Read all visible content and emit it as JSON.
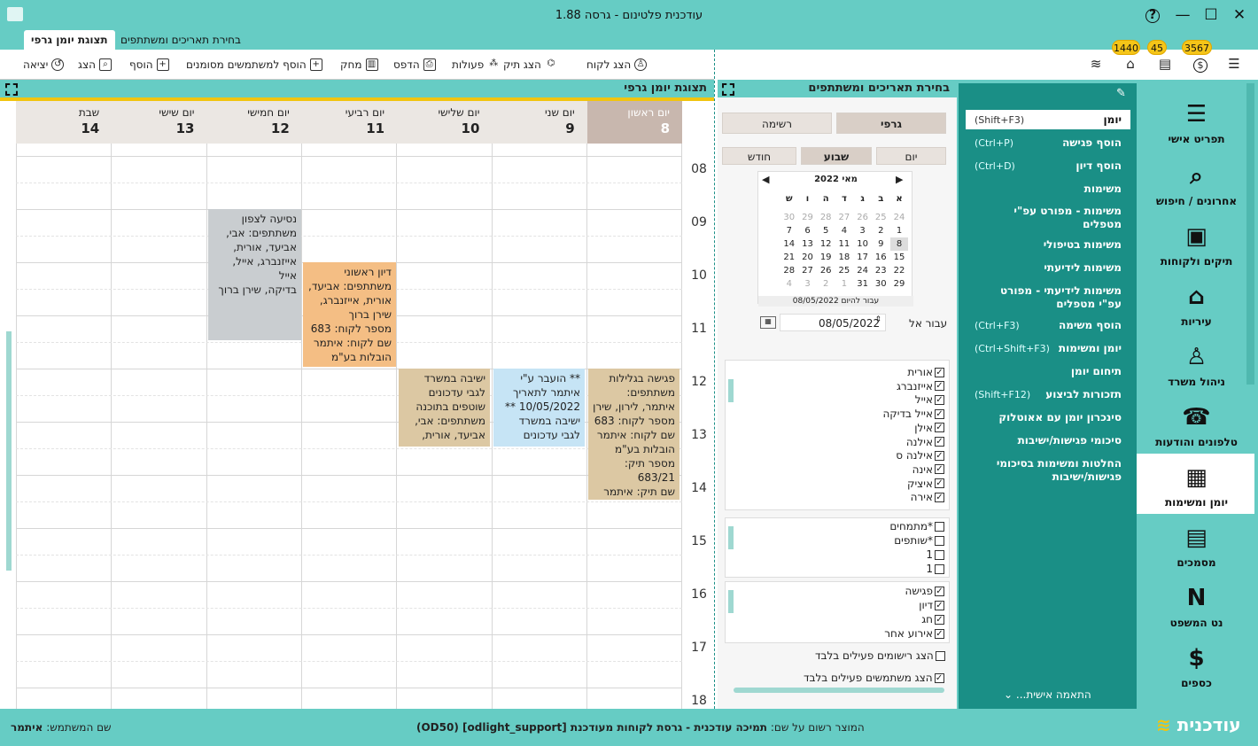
{
  "window": {
    "title": "עודכנית פלטינום - גרסה 1.88",
    "help": "?",
    "minimize": "—",
    "maximize": "☐",
    "close": "✕"
  },
  "tabs": [
    "תצוגת יומן גרפי",
    "בחירת תאריכים ומשתתפים"
  ],
  "toolbar": {
    "show_client": "הצג לקוח",
    "show_file": "הצג תיק",
    "actions": "פעולות",
    "print": "הדפס",
    "delete": "מחק",
    "add_marked": "הוסף למשתמשים מסומנים",
    "add": "הוסף",
    "show": "הצג",
    "exit": "יציאה"
  },
  "badges": [
    "1440",
    "45",
    "3567"
  ],
  "calendar": {
    "header": "תצוגת יומן גרפי",
    "days": [
      {
        "name": "יום ראשון",
        "date": "8"
      },
      {
        "name": "יום שני",
        "date": "9"
      },
      {
        "name": "יום שלישי",
        "date": "10"
      },
      {
        "name": "יום רביעי",
        "date": "11"
      },
      {
        "name": "יום חמישי",
        "date": "12"
      },
      {
        "name": "יום שישי",
        "date": "13"
      },
      {
        "name": "שבת",
        "date": "14"
      }
    ],
    "hours": [
      "08",
      "09",
      "10",
      "11",
      "12",
      "13",
      "14",
      "15",
      "16",
      "17",
      "18"
    ],
    "events": [
      {
        "text": "נסיעה לצפון\nמשתתפים: אבי,\nאביעד, אורית,\nאייזנברג, אייל, אייל\nבדיקה, שירן ברוך",
        "color": "#c9cdd0"
      },
      {
        "text": "דיון ראשוני\nמשתתפים: אביעד,\nאורית, אייזנברג,\nשירן ברוך\nמספר לקוח: 683\nשם לקוח: איתמר\nהובלות בע\"מ",
        "color": "#f4be84"
      },
      {
        "text": "ישיבה במשרד\nלגבי עדכונים\nשוטפים בתוכנה\nמשתתפים: אבי,\nאביעד, אורית,",
        "color": "#dcc8a3"
      },
      {
        "text": "** הועבר ע\"י\nאיתמר לתאריך\n10/05/2022 **\nישיבה במשרד\nלגבי עדכונים",
        "color": "#c6e4f5"
      },
      {
        "text": "פגישה בגלילות\nמשתתפים:\nאיתמר, לירון, שירן\nמספר לקוח: 683\nשם לקוח: איתמר\nהובלות בע\"מ\nמספר תיק:\n683/21\nשם תיק: איתמר",
        "color": "#dcc8a3"
      }
    ]
  },
  "dates_panel": {
    "header": "בחירת תאריכים ומשתתפים",
    "graphic": "גרפי",
    "list": "רשימה",
    "day": "יום",
    "week": "שבוע",
    "month": "חודש",
    "month_label": "מאי 2022",
    "weekday_headers": [
      "א",
      "ב",
      "ג",
      "ד",
      "ה",
      "ו",
      "ש"
    ],
    "weeks": [
      [
        "24",
        "25",
        "26",
        "27",
        "28",
        "29",
        "30"
      ],
      [
        "1",
        "2",
        "3",
        "4",
        "5",
        "6",
        "7"
      ],
      [
        "8",
        "9",
        "10",
        "11",
        "12",
        "13",
        "14"
      ],
      [
        "15",
        "16",
        "17",
        "18",
        "19",
        "20",
        "21"
      ],
      [
        "22",
        "23",
        "24",
        "25",
        "26",
        "27",
        "28"
      ],
      [
        "29",
        "30",
        "31",
        "1",
        "2",
        "3",
        "4"
      ]
    ],
    "goto_today": "עבור להיום 08/05/2022",
    "goto_label": "עבור אל",
    "goto_value": "08/05/2022",
    "users": [
      "אורית",
      "אייזנברג",
      "אייל",
      "אייל בדיקה",
      "אילן",
      "אילנה",
      "אילנה ס",
      "אינה",
      "איציק",
      "אירה"
    ],
    "groups": [
      "*מתמחים",
      "*שותפים",
      "1",
      "1"
    ],
    "types": [
      "פגישה",
      "דיון",
      "חג",
      "אירוע אחר"
    ],
    "show_active_records": "הצג רישומים פעילים בלבד",
    "show_active_users": "הצג משתמשים פעילים בלבד"
  },
  "menu": {
    "items": [
      {
        "label": "יומן",
        "shortcut": "(Shift+F3)"
      },
      {
        "label": "הוסף פגישה",
        "shortcut": "(Ctrl+P)"
      },
      {
        "label": "הוסף דיון",
        "shortcut": "(Ctrl+D)"
      },
      {
        "label": "משימות",
        "shortcut": ""
      },
      {
        "label": "משימות - מפורט עפ\"י\nמטפלים",
        "shortcut": ""
      },
      {
        "label": "משימות בטיפולי",
        "shortcut": ""
      },
      {
        "label": "משימות לידיעתי",
        "shortcut": ""
      },
      {
        "label": "משימות לידיעתי - מפורט\nעפ\"י מטפלים",
        "shortcut": ""
      },
      {
        "label": "הוסף משימה",
        "shortcut": "(Ctrl+F3)"
      },
      {
        "label": "יומן ומשימות",
        "shortcut": "(Ctrl+Shift+F3)"
      },
      {
        "label": "תיחום יומן",
        "shortcut": ""
      },
      {
        "label": "תזכורות לביצוע",
        "shortcut": "(Shift+F12)"
      },
      {
        "label": "סינכרון יומן עם אאוטלוק",
        "shortcut": ""
      },
      {
        "label": "סיכומי פגישות/ישיבות",
        "shortcut": ""
      },
      {
        "label": "החלטות ומשימות בסיכומי\nפגישות/ישיבות",
        "shortcut": ""
      }
    ],
    "personalize": "התאמה אישית..."
  },
  "nav": [
    {
      "label": "תפריט אישי",
      "icon": "☰"
    },
    {
      "label": "אחרונים / חיפוש",
      "icon": "⌕"
    },
    {
      "label": "תיקים ולקוחות",
      "icon": "▣"
    },
    {
      "label": "עיריות",
      "icon": "⌂"
    },
    {
      "label": "ניהול משרד",
      "icon": "♙"
    },
    {
      "label": "טלפונים והודעות",
      "icon": "☎"
    },
    {
      "label": "יומן ומשימות",
      "icon": "▦"
    },
    {
      "label": "מסמכים",
      "icon": "▤"
    },
    {
      "label": "נט המשפט",
      "icon": "N"
    },
    {
      "label": "כספים",
      "icon": "$"
    }
  ],
  "status": {
    "user_label": "שם המשתמש:",
    "user_value": "איתמר",
    "product_line": "גרסת לקוחות מעודכנת [odlight_support] (OD50)",
    "registered_label": "המוצר רשום על שם:",
    "registered_value": "תמיכה עודכנית -",
    "brand": "עודכנית"
  }
}
